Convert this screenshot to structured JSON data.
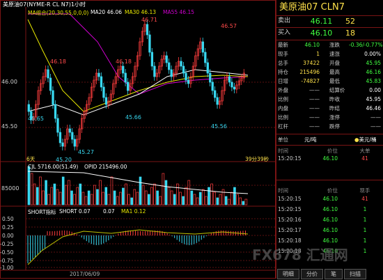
{
  "chart": {
    "legend": {
      "title": "美原油07(NYME-R CL N7)1小时",
      "ma_group": "MA组合(20,30,55,0,0,0)",
      "ma20": "MA20 46.06",
      "ma30": "MA30 46.13",
      "ma55": "MA55 46.15"
    },
    "price_labels": [
      "46.00",
      "45.50"
    ],
    "annotations": {
      "a1": "46.18",
      "a2": "46.18",
      "a3": "46.71",
      "a4": "46.57",
      "a5": "45.65",
      "a6": "45.20",
      "a7": "45.27",
      "a8": "45.66",
      "a9": "45.56"
    },
    "x_start_label": "6天",
    "time_remaining": "39分39秒",
    "date_label": "2017/06/09",
    "volume": {
      "legend_cjl": "CJL 5716.00(51.49)",
      "legend_opid": "OPID 215496.00",
      "axis_label": "85000"
    },
    "short": {
      "legend_name": "SHORT指标",
      "legend_short": "SHORT 0.07",
      "legend_val": "0.07",
      "legend_ma1": "MA1 0.12",
      "axis": [
        "0.50",
        "0.25",
        "0.00",
        "-0.25",
        "-0.50",
        "-0.75",
        "-1.00"
      ]
    },
    "colors": {
      "candle_up": "#ff3d3d",
      "candle_down": "#38d8f0",
      "ma20": "#ffffff",
      "ma30": "#e8e800",
      "ma55": "#d000d0",
      "ma_short": "#c0c000"
    }
  },
  "panel": {
    "title": "美原油07  CLN7",
    "sell_label": "卖出",
    "sell_price": "46.11",
    "sell_vol": "52",
    "buy_label": "买入",
    "buy_price": "46.10",
    "buy_vol": "18",
    "rows": [
      {
        "l": "最新",
        "v": "46.10",
        "vc": "#40ff40",
        "l2": "涨跌",
        "v2": "-0.36/-0.77%",
        "v2c": "#40ff40"
      },
      {
        "l": "现手",
        "v": "1",
        "vc": "#ffe24a",
        "l2": "速涨",
        "v2": "0.00%",
        "v2c": "#ffffff"
      },
      {
        "l": "总手",
        "v": "37422",
        "vc": "#ffe24a",
        "l2": "开盘",
        "v2": "45.95",
        "v2c": "#40ff40"
      },
      {
        "l": "持仓",
        "v": "215496",
        "vc": "#ffe24a",
        "l2": "最高",
        "v2": "46.16",
        "v2c": "#40ff40"
      },
      {
        "l": "日增",
        "v": "-74827",
        "vc": "#ffe24a",
        "l2": "最低",
        "v2": "45.83",
        "v2c": "#40ff40"
      },
      {
        "l": "外盘",
        "v": "——",
        "vc": "#c8c8c8",
        "l2": "结算价",
        "v2": "0.00",
        "v2c": "#ffffff"
      },
      {
        "l": "比例",
        "v": "——",
        "vc": "#c8c8c8",
        "l2": "昨收",
        "v2": "45.95",
        "v2c": "#ffffff"
      },
      {
        "l": "内盘",
        "v": "——",
        "vc": "#c8c8c8",
        "l2": "昨结",
        "v2": "46.46",
        "v2c": "#ffffff"
      },
      {
        "l": "比例",
        "v": "——",
        "vc": "#c8c8c8",
        "l2": "涨停",
        "v2": "——",
        "v2c": "#c8c8c8"
      },
      {
        "l": "杠杆",
        "v": "——",
        "vc": "#c8c8c8",
        "l2": "跌停",
        "v2": "——",
        "v2c": "#c8c8c8"
      }
    ],
    "unit_label": "单位",
    "unit_value": "元/吨",
    "currency": "美元/桶",
    "ticks1_header": {
      "time": "时间",
      "price": "价位",
      "vol": "大单"
    },
    "ticks1": [
      {
        "t": "15:20:15",
        "p": "46.10",
        "v": "41"
      }
    ],
    "ticks2_header": {
      "time": "时间",
      "price": "价位",
      "vol": "现手"
    },
    "ticks2": [
      {
        "t": "15:20:15",
        "p": "46.10",
        "v": "41"
      },
      {
        "t": "15:20:15",
        "p": "46.10",
        "v": "1"
      },
      {
        "t": "15:20:16",
        "p": "46.10",
        "v": "1"
      },
      {
        "t": "15:20:17",
        "p": "46.10",
        "v": "1"
      },
      {
        "t": "15:20:18",
        "p": "46.10",
        "v": "1"
      },
      {
        "t": "15:20:18",
        "p": "46.10",
        "v": "1"
      }
    ],
    "tabs": [
      "明细",
      "分价",
      "笔",
      "扫描"
    ]
  },
  "watermark": "FX678 汇通网"
}
